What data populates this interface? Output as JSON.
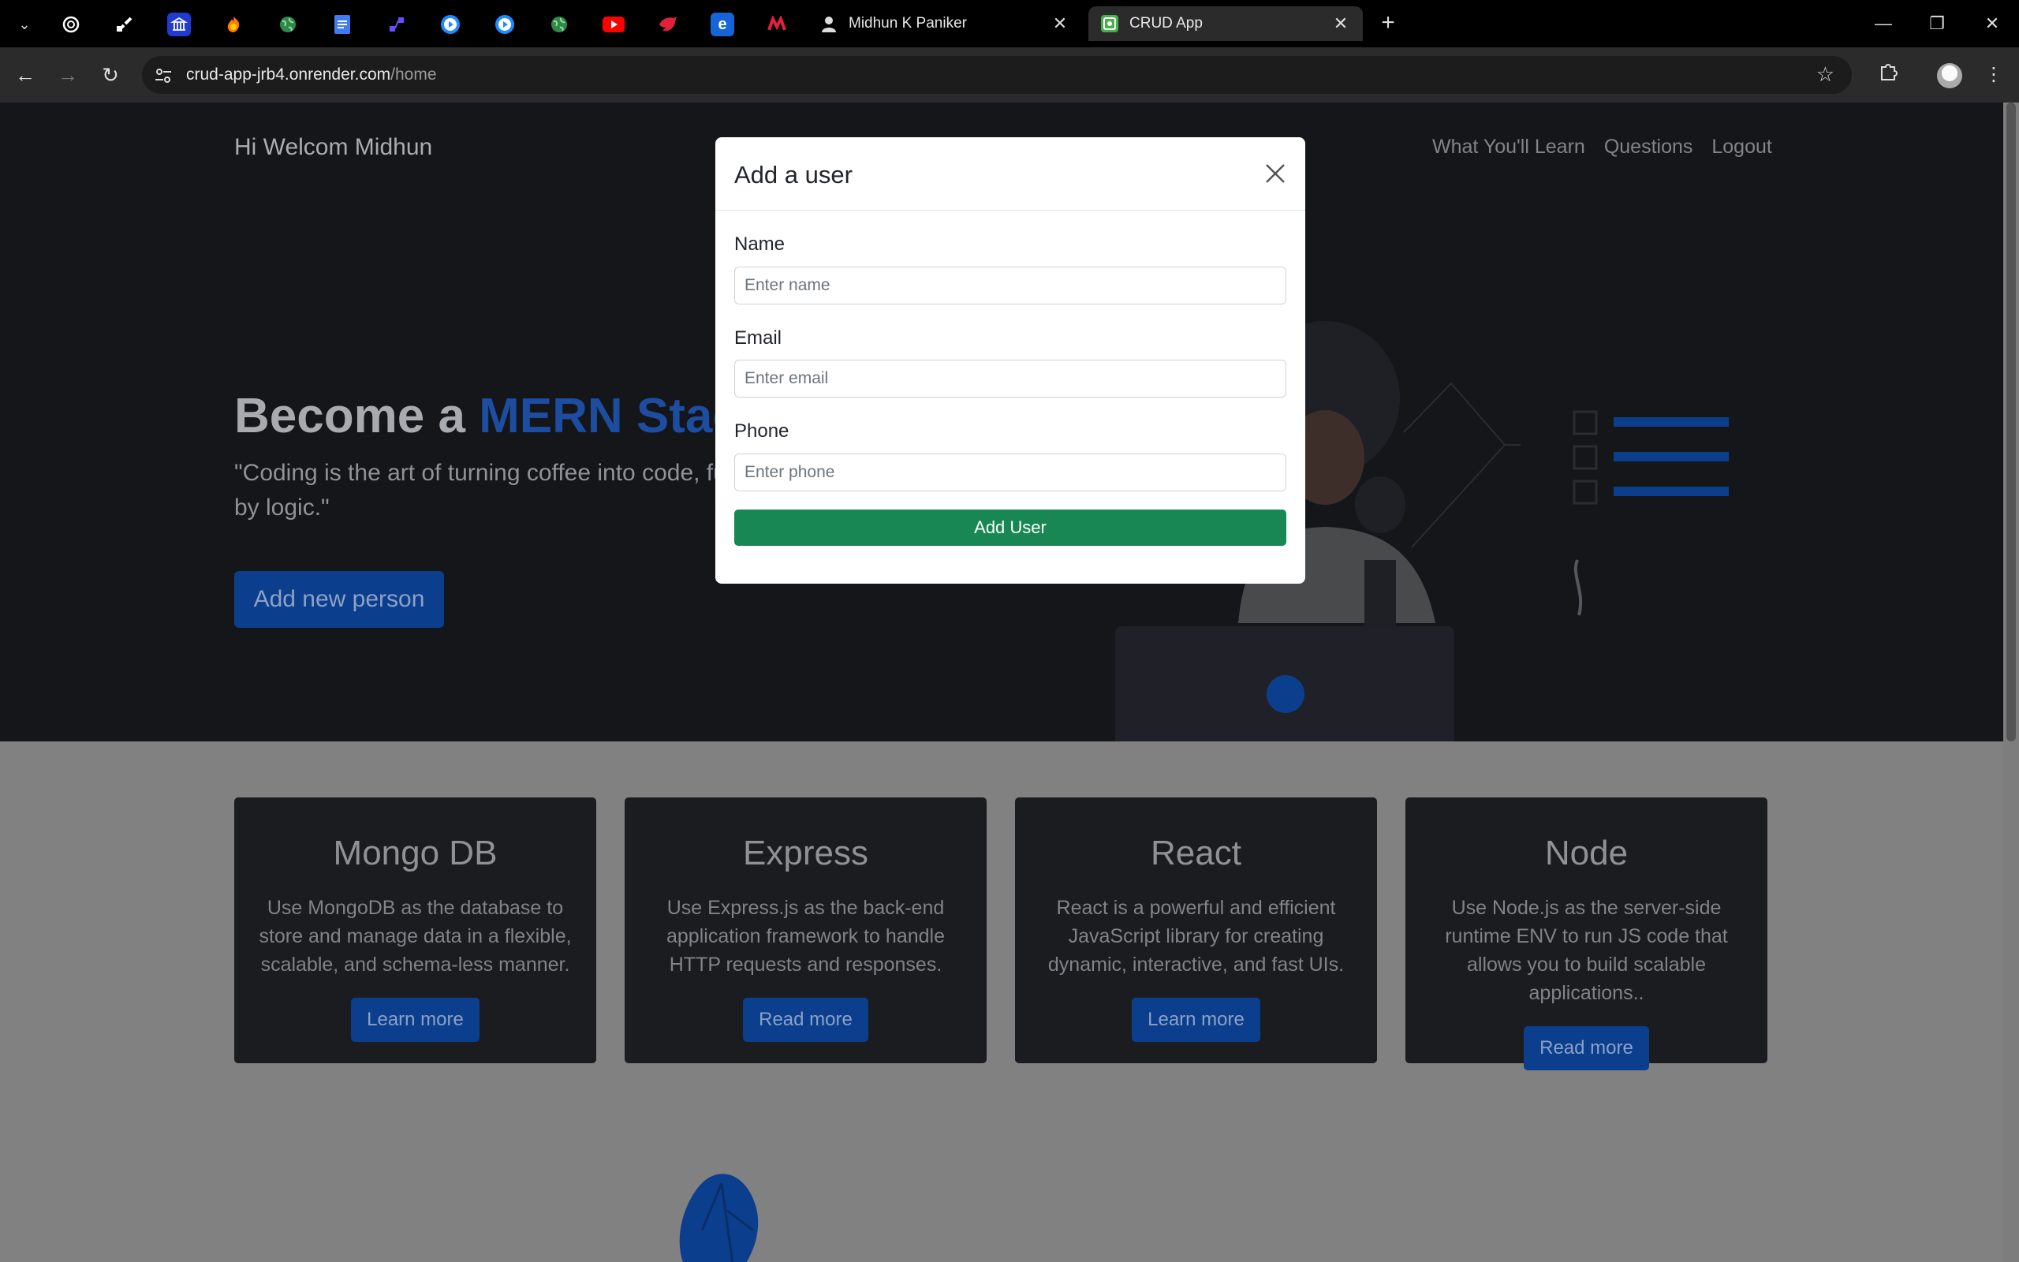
{
  "browser": {
    "tabs": [
      {
        "title": "Midhun K Paniker",
        "close": "✕"
      },
      {
        "title": "CRUD App",
        "close": "✕"
      }
    ],
    "new_tab": "+",
    "url_host": "crud-app-jrb4.onrender.com",
    "url_path": "/home",
    "pinned_icons": [
      "openai-icon",
      "bitbucket-icon",
      "bank-icon",
      "firefox-icon",
      "globe-icon",
      "docs-icon",
      "workflow-icon",
      "record-icon",
      "record-icon",
      "globe-icon",
      "youtube-icon",
      "bird-icon",
      "edge-icon",
      "app-icon"
    ]
  },
  "navbar": {
    "brand": "Hi Welcom Midhun",
    "links": [
      "What You'll Learn",
      "Questions",
      "Logout"
    ]
  },
  "hero": {
    "headline_prefix": "Become a ",
    "headline_accent": "MERN Stack",
    "quote_line1": "\"Coding is the art of turning coffee into code, fue",
    "quote_line2": "by logic.\"",
    "add_button": "Add new person"
  },
  "cards": [
    {
      "title": "Mongo DB",
      "text": "Use MongoDB as the database to store and manage data in a flexible, scalable, and schema-less manner.",
      "button": "Learn more"
    },
    {
      "title": "Express",
      "text": "Use Express.js as the back-end application framework to handle HTTP requests and responses.",
      "button": "Read more"
    },
    {
      "title": "React",
      "text": "React is a powerful and efficient JavaScript library for creating dynamic, interactive, and fast UIs.",
      "button": "Learn more"
    },
    {
      "title": "Node",
      "text": "Use Node.js as the server-side runtime ENV to run JS code that allows you to build scalable applications..",
      "button": "Read more"
    }
  ],
  "modal": {
    "title": "Add a user",
    "name_label": "Name",
    "name_placeholder": "Enter name",
    "email_label": "Email",
    "email_placeholder": "Enter email",
    "phone_label": "Phone",
    "phone_placeholder": "Enter phone",
    "submit": "Add User"
  },
  "colors": {
    "accent": "#1c4da0",
    "primary_button": "#0b3f8e",
    "success_button": "#198754",
    "hero_bg": "#151619",
    "overlay_bg": "#818181"
  }
}
